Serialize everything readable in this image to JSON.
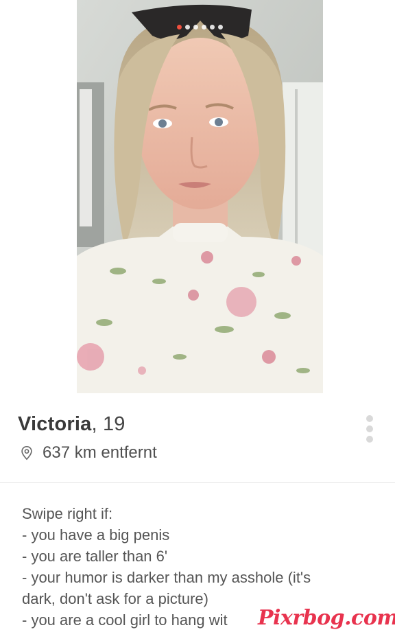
{
  "photo": {
    "dots_total": 6,
    "dots_active_index": 0,
    "accent": "#f0503f"
  },
  "profile": {
    "name": "Victoria",
    "age_suffix": ", 19",
    "distance": "637 km entfernt",
    "location_icon": "location-pin-icon",
    "more_icon": "vertical-dots-icon"
  },
  "bio": {
    "lines": [
      "Swipe right if:",
      "- you have a big penis",
      "- you are taller than 6'",
      "- your humor is darker than my asshole (it's",
      "dark, don't ask for a picture)",
      "- you are a cool girl to hang wit"
    ]
  },
  "watermark": {
    "text": "Pixrbog.com",
    "color": "#e8334e"
  }
}
